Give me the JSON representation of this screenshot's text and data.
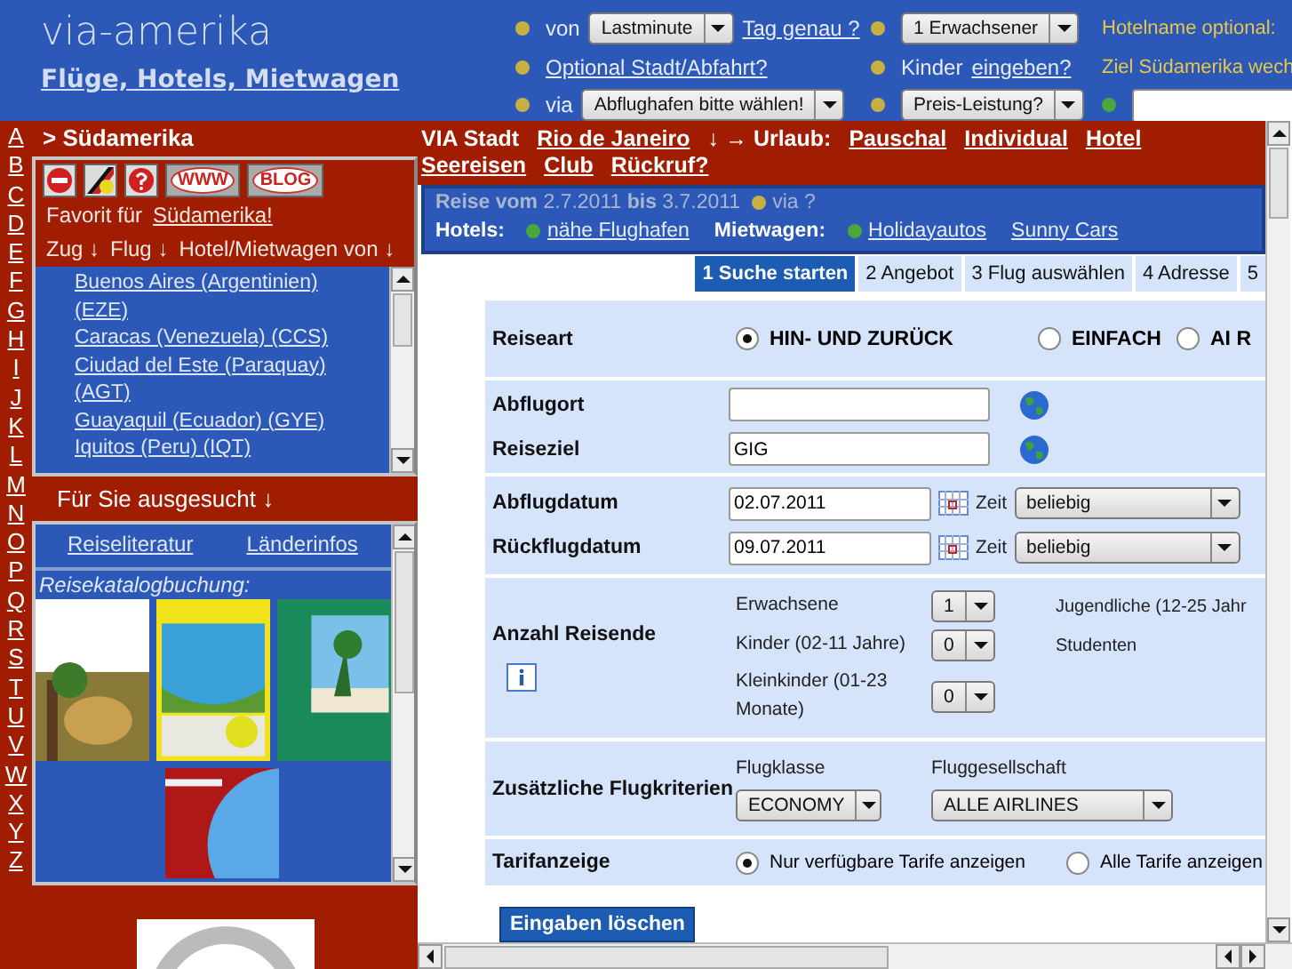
{
  "header": {
    "title": "via-amerika",
    "subtitle": "Flüge, Hotels, Mietwagen",
    "cells": [
      {
        "items": [
          {
            "kind": "bullet",
            "color": "#c8b040"
          },
          {
            "kind": "label",
            "text": "von"
          },
          {
            "kind": "select",
            "text": "Lastminute"
          },
          {
            "kind": "link",
            "text": "Tag genau ?"
          }
        ]
      },
      {
        "items": [
          {
            "kind": "bullet",
            "color": "#c8b040"
          },
          {
            "kind": "select",
            "text": "1 Erwachsener"
          }
        ]
      },
      {
        "items": [
          {
            "kind": "note",
            "text": "Hotelname optional:"
          }
        ]
      },
      {
        "items": [
          {
            "kind": "bullet",
            "color": "#c8b040"
          },
          {
            "kind": "link",
            "text": "Optional Stadt/Abfahrt?"
          }
        ]
      },
      {
        "items": [
          {
            "kind": "bullet",
            "color": "#c8b040"
          },
          {
            "kind": "label",
            "text": "Kinder"
          },
          {
            "kind": "link",
            "text": "eingeben?"
          }
        ]
      },
      {
        "items": [
          {
            "kind": "note",
            "text": "Ziel Südamerika wech"
          }
        ]
      },
      {
        "items": [
          {
            "kind": "bullet",
            "color": "#c8b040"
          },
          {
            "kind": "label",
            "text": "via"
          },
          {
            "kind": "select",
            "text": "Abflughafen bitte wählen!"
          }
        ]
      },
      {
        "items": [
          {
            "kind": "bullet",
            "color": "#c8b040"
          },
          {
            "kind": "select",
            "text": "Preis-Leistung?"
          }
        ]
      },
      {
        "items": [
          {
            "kind": "bullet",
            "color": "#4aa83a"
          },
          {
            "kind": "input"
          }
        ]
      }
    ]
  },
  "letters": [
    "A",
    "B",
    "C",
    "D",
    "E",
    "F",
    "G",
    "H",
    "I",
    "J",
    "K",
    "L",
    "M",
    "N",
    "O",
    "P",
    "Q",
    "R",
    "S",
    "T",
    "U",
    "V",
    "W",
    "X",
    "Y",
    "Z"
  ],
  "region": {
    "title": "> Südamerika",
    "icon_buttons": [
      {
        "kind": "back"
      },
      {
        "kind": "flag"
      },
      {
        "kind": "help"
      },
      {
        "kind": "oval",
        "text": "WWW"
      },
      {
        "kind": "oval",
        "text": "BLOG"
      }
    ],
    "favorite": {
      "text": "Favorit für",
      "link": "Südamerika!"
    },
    "transport": [
      "Zug ↓",
      "Flug ↓",
      "Hotel/Mietwagen von ↓"
    ],
    "airports": [
      "Buenos Aires (Argentinien) (EZE)",
      "Caracas (Venezuela) (CCS)",
      "Ciudad del Este (Paraquay) (AGT)",
      "Guayaquil (Ecuador) (GYE)",
      "Iquitos (Peru) (IQT)"
    ]
  },
  "recommended": {
    "title": "Für Sie ausgesucht ↓",
    "links": [
      "Reiseliteratur",
      "Länderinfos"
    ],
    "catalog_label": "Reisekatalogbuchung:",
    "catalogs": [
      {
        "kind": "picture"
      },
      {
        "kind": "picture"
      },
      {
        "kind": "picture"
      },
      {
        "kind": "picture"
      }
    ],
    "badge": {
      "kind": "picture"
    }
  },
  "destination_bar": [
    {
      "kind": "text",
      "text": "VIA Stadt"
    },
    {
      "kind": "link",
      "text": "Rio de Janeiro"
    },
    {
      "kind": "text",
      "text": "↓ → Urlaub:"
    },
    {
      "kind": "link",
      "text": "Pauschal"
    },
    {
      "kind": "link",
      "text": "Individual"
    },
    {
      "kind": "link",
      "text": "Hotel"
    },
    {
      "kind": "link",
      "text": "Seereisen"
    },
    {
      "kind": "link",
      "text": "Club"
    },
    {
      "kind": "link",
      "text": "Rückruf?"
    }
  ],
  "trip_bar": {
    "dates": "**Reise vom** 2.7.2011 **bis** 3.7.2011",
    "via": "via ?",
    "hotels_label": "Hotels:",
    "hotel_links": [
      "nähe Flughafen"
    ],
    "car_label": "Mietwagen:",
    "car_links": [
      "Holidayautos",
      "Sunny Cars"
    ]
  },
  "steps": [
    {
      "label": "1 Suche starten",
      "selected": true
    },
    {
      "label": "2 Angebot",
      "selected": false
    },
    {
      "label": "3 Flug auswählen",
      "selected": false
    },
    {
      "label": "4 Adresse",
      "selected": false
    },
    {
      "label": "5",
      "selected": false
    }
  ],
  "form": [
    {
      "kind": "radio",
      "label": "Reiseart",
      "options": [
        {
          "label": "HIN- UND ZURÜCK",
          "selected": true
        },
        {
          "label": "EINFACH",
          "selected": false
        },
        {
          "label": "AI R",
          "selected": false
        }
      ]
    },
    {
      "kind": "fields",
      "rows": [
        {
          "kind": "place",
          "label": "Abflugort"
        },
        {
          "kind": "place",
          "label": "Reiseziel",
          "value": "GIG"
        }
      ]
    },
    {
      "kind": "fields",
      "rows": [
        {
          "kind": "date",
          "label": "Abflugdatum",
          "value": "02.07.2011",
          "time_label": "Zeit",
          "time": "beliebig"
        },
        {
          "kind": "date",
          "label": "Rückflugdatum",
          "value": "09.07.2011",
          "time_label": "Zeit",
          "time": "beliebig"
        }
      ]
    },
    {
      "kind": "travelers",
      "label": "Anzahl Reisende",
      "counters": [
        {
          "label": "Erwachsene",
          "value": "1"
        },
        {
          "label": "Kinder (02-11 Jahre)",
          "value": "0"
        },
        {
          "label": "Kleinkinder (01-23 Monate)",
          "value": "0"
        }
      ],
      "notes": [
        "Jugendliche (12-25 Jahr",
        "Studenten"
      ]
    },
    {
      "kind": "criteria",
      "label": "Zusätzliche Flugkriterien",
      "selects": [
        {
          "caption": "Flugklasse",
          "value": "ECONOMY"
        },
        {
          "caption": "Fluggesellschaft",
          "value": "ALLE AIRLINES"
        }
      ]
    },
    {
      "kind": "choice",
      "label": "Tarifanzeige",
      "options": [
        {
          "label": "Nur verfügbare Tarife anzeigen",
          "selected": true
        },
        {
          "label": "Alle Tarife anzeigen",
          "selected": false
        }
      ]
    }
  ],
  "clear_button": "Eingaben löschen"
}
